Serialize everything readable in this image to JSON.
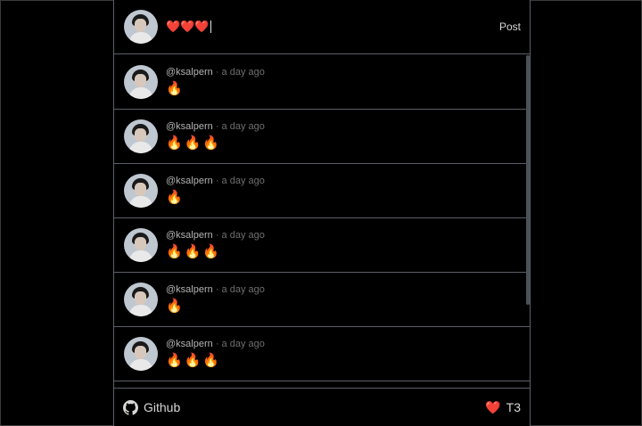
{
  "composer": {
    "value": "❤️❤️❤️",
    "post_label": "Post"
  },
  "posts": [
    {
      "handle": "@ksalpern",
      "separator": "·",
      "time": "a day ago",
      "content": "🔥"
    },
    {
      "handle": "@ksalpern",
      "separator": "·",
      "time": "a day ago",
      "content": "🔥🔥🔥"
    },
    {
      "handle": "@ksalpern",
      "separator": "·",
      "time": "a day ago",
      "content": "🔥"
    },
    {
      "handle": "@ksalpern",
      "separator": "·",
      "time": "a day ago",
      "content": "🔥🔥🔥"
    },
    {
      "handle": "@ksalpern",
      "separator": "·",
      "time": "a day ago",
      "content": "🔥"
    },
    {
      "handle": "@ksalpern",
      "separator": "·",
      "time": "a day ago",
      "content": "🔥🔥🔥"
    }
  ],
  "footer": {
    "github_label": "Github",
    "github_icon": "github-icon",
    "t3_heart": "❤️",
    "t3_label": "T3"
  },
  "colors": {
    "background": "#000000",
    "border": "#5b5f66",
    "avatar_bg": "#bfc7d1",
    "meta_text": "#b3b3b3",
    "time_text": "#6f6f6f"
  }
}
